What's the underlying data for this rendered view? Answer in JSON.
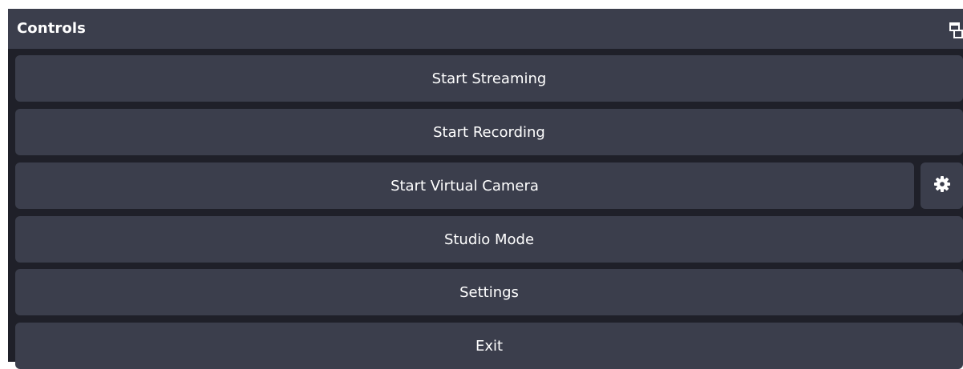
{
  "dock": {
    "title": "Controls",
    "float_icon": "undock-icon"
  },
  "buttons": {
    "start_streaming": "Start Streaming",
    "start_recording": "Start Recording",
    "start_virtual_camera": "Start Virtual Camera",
    "virtual_camera_settings_icon": "gear-icon",
    "studio_mode": "Studio Mode",
    "settings": "Settings",
    "exit": "Exit"
  },
  "colors": {
    "panel_background": "#1f2029",
    "button_background": "#3b3e4c",
    "text": "#ffffff"
  }
}
